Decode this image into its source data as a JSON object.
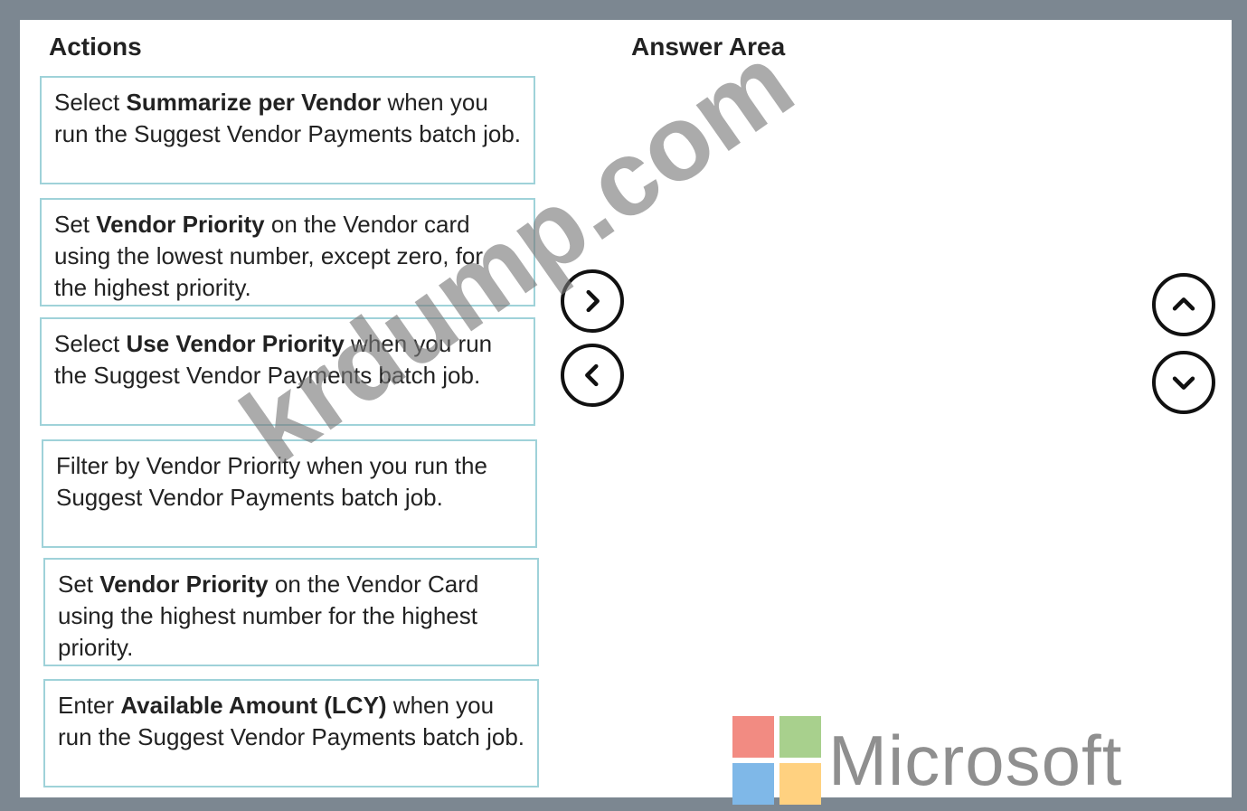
{
  "headings": {
    "actions": "Actions",
    "answer_area": "Answer Area"
  },
  "actions": [
    {
      "pre": "Select ",
      "bold": "Summarize per Vendor",
      "post": " when you run the Suggest Vendor Payments batch job."
    },
    {
      "pre": "Set ",
      "bold": "Vendor Priority",
      "post": " on the Vendor card using the lowest number, except zero, for the highest priority."
    },
    {
      "pre": "Select ",
      "bold": "Use Vendor Priority",
      "post": " when you run the Suggest Vendor Payments batch job."
    },
    {
      "pre": "Filter by Vendor Priority when you run the Suggest Vendor Payments batch job.",
      "bold": "",
      "post": ""
    },
    {
      "pre": "Set ",
      "bold": "Vendor Priority",
      "post": " on the Vendor Card using the highest number for the highest priority."
    },
    {
      "pre": "Enter ",
      "bold": "Available Amount (LCY)",
      "post": " when you run the Suggest Vendor Payments batch job."
    }
  ],
  "controls": {
    "move_right_icon": "chevron-right-icon",
    "move_left_icon": "chevron-left-icon",
    "move_up_icon": "chevron-up-icon",
    "move_down_icon": "chevron-down-icon"
  },
  "watermark": "krdump.com",
  "logo": {
    "text": "Microsoft",
    "colors": [
      "#f28b82",
      "#a8d08d",
      "#7fb8e8",
      "#ffd180"
    ]
  }
}
